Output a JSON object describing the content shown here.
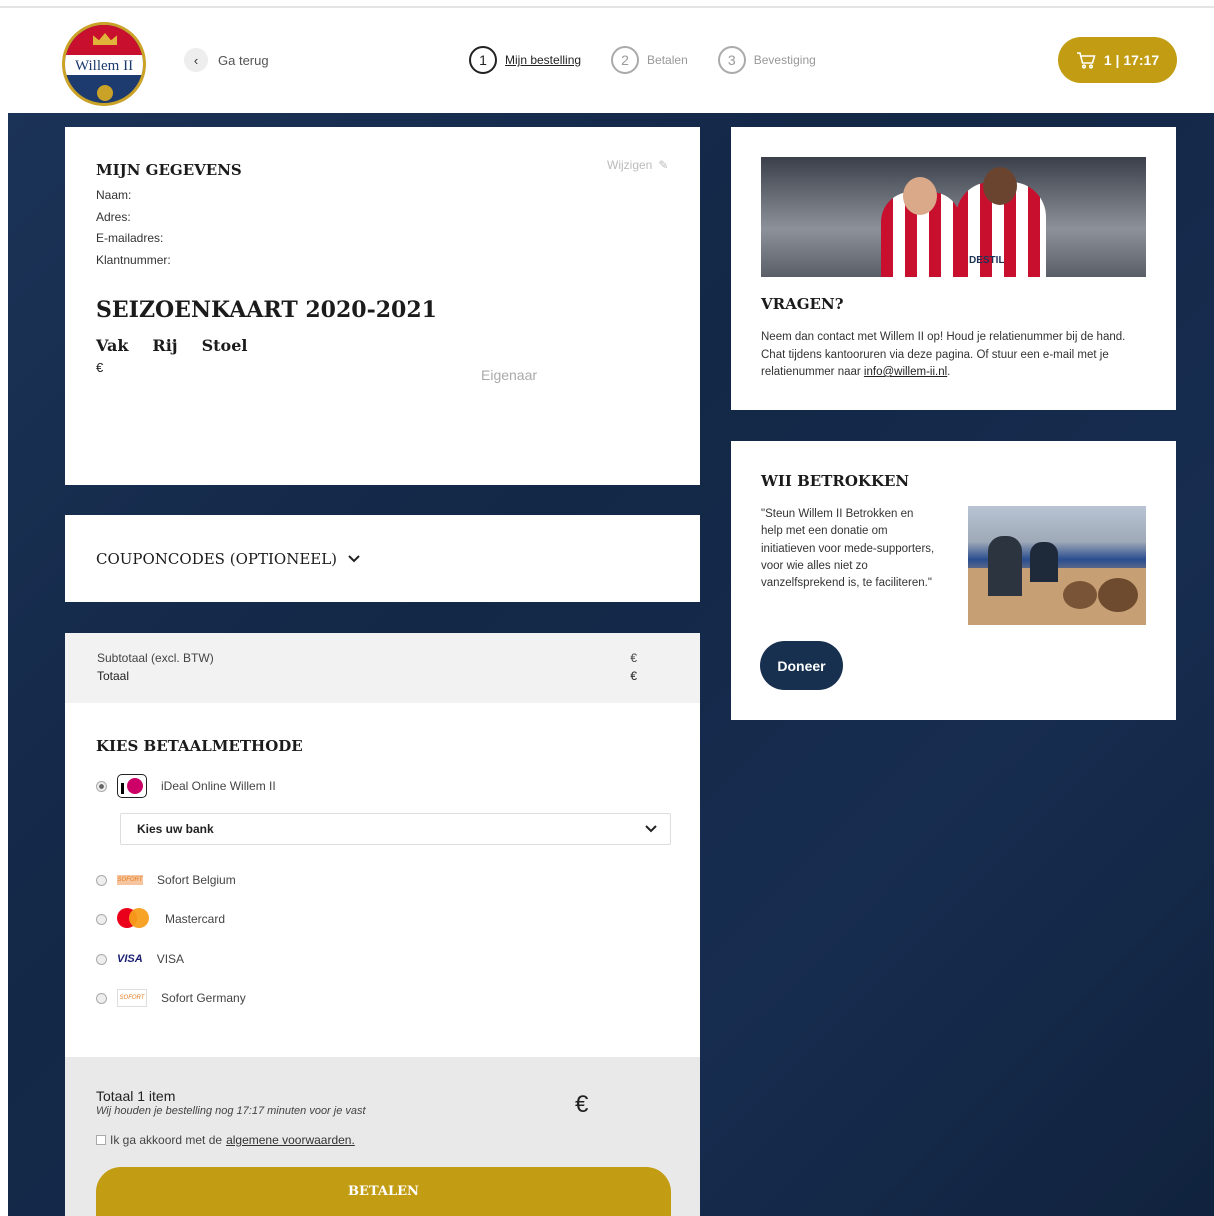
{
  "header": {
    "logo_text": "Willem II",
    "back_label": "Ga terug",
    "steps": [
      {
        "num": "1",
        "label": "Mijn bestelling"
      },
      {
        "num": "2",
        "label": "Betalen"
      },
      {
        "num": "3",
        "label": "Bevestiging"
      }
    ],
    "cart_label": "1 | 17:17"
  },
  "gegevens": {
    "title": "MIJN GEGEVENS",
    "edit_label": "Wijzigen",
    "fields": [
      "Naam:",
      "Adres:",
      "E-mailadres:",
      "Klantnummer:"
    ]
  },
  "season": {
    "title": "SEIZOENKAART 2020-2021",
    "columns": [
      "Vak",
      "Rij",
      "Stoel"
    ],
    "price": "€",
    "owner_label": "Eigenaar"
  },
  "coupon": {
    "title": "COUPONCODES (OPTIONEEL)"
  },
  "summary": {
    "subtotal_label": "Subtotaal (excl. BTW)",
    "subtotal_value": "€",
    "total_label": "Totaal",
    "total_value": "€"
  },
  "payment": {
    "title": "KIES BETAALMETHODE",
    "methods": [
      "iDeal Online Willem II",
      "Sofort Belgium",
      "Mastercard",
      "VISA",
      "Sofort Germany"
    ],
    "bank_placeholder": "Kies uw bank",
    "visa_logo": "VISA",
    "sofort_logo": "SOFORT"
  },
  "checkout": {
    "total_items": "Totaal 1 item",
    "hold_text": "Wij houden je bestelling nog 17:17 minuten voor je vast",
    "total_value": "€",
    "agree_prefix": "Ik ga akkoord met de",
    "agree_link": "algemene voorwaarden.",
    "pay_button": "BETALEN"
  },
  "vragen": {
    "title": "VRAGEN?",
    "text": "Neem dan contact met Willem II op! Houd je relatienummer bij de hand. Chat tijdens kantooruren via deze pagina. Of stuur een e-mail met je relatienummer naar",
    "email": "info@willem-ii.nl",
    "end": ".",
    "sponsor": "DESTIL"
  },
  "betrokken": {
    "title": "WII BETROKKEN",
    "quote": "\"Steun Willem II Betrokken en help met een donatie om initiatieven voor mede-supporters, voor wie alles niet zo vanzelfsprekend is, te faciliteren.\"",
    "button": "Doneer"
  },
  "colors": {
    "gold": "#c29c12",
    "navy": "#18304f"
  }
}
